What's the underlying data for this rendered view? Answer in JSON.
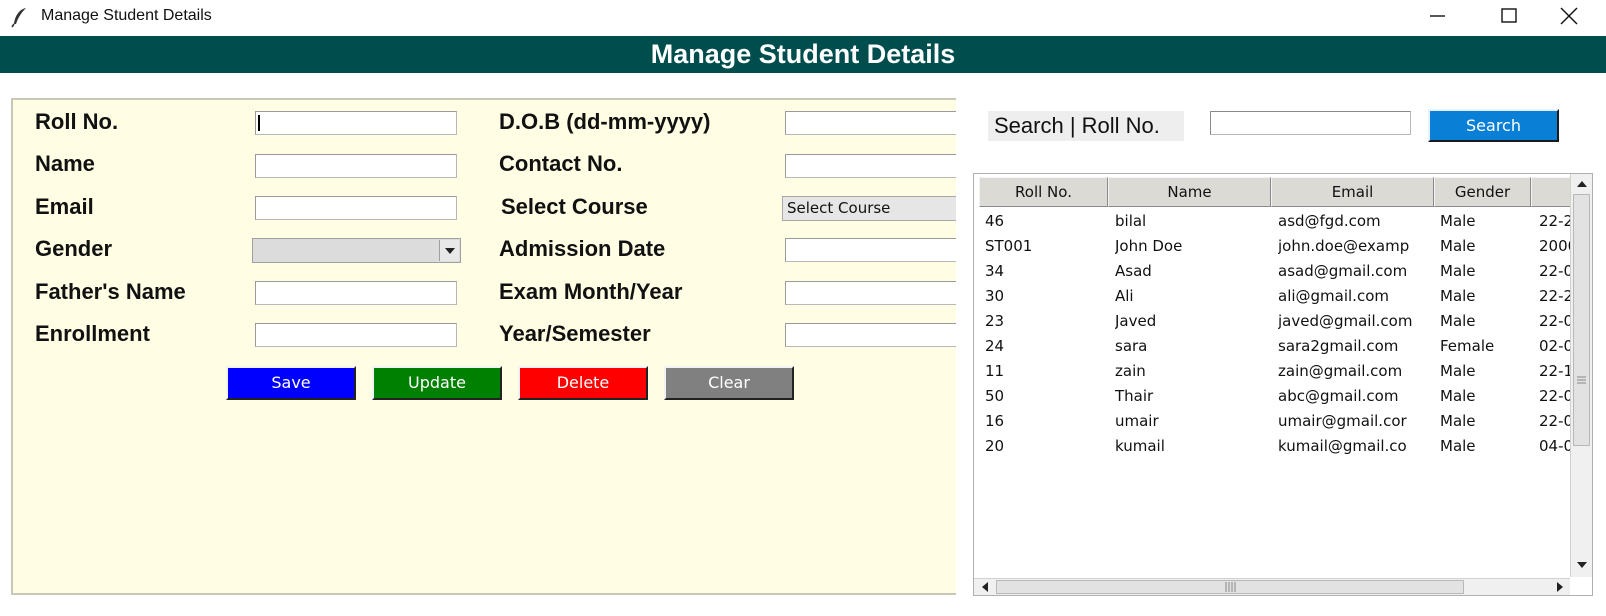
{
  "window": {
    "title": "Manage Student Details"
  },
  "banner": {
    "title": "Manage Student Details"
  },
  "form": {
    "fields_left": [
      {
        "label": "Roll No.",
        "value": ""
      },
      {
        "label": "Name",
        "value": ""
      },
      {
        "label": "Email",
        "value": ""
      },
      {
        "label": "Gender",
        "value": ""
      },
      {
        "label": "Father's Name",
        "value": ""
      },
      {
        "label": "Enrollment",
        "value": ""
      }
    ],
    "fields_right": [
      {
        "label": "D.O.B (dd-mm-yyyy)",
        "value": ""
      },
      {
        "label": "Contact No.",
        "value": ""
      },
      {
        "label": "Select Course",
        "value": "Select Course"
      },
      {
        "label": "Admission Date",
        "value": ""
      },
      {
        "label": "Exam Month/Year",
        "value": ""
      },
      {
        "label": "Year/Semester",
        "value": ""
      }
    ],
    "buttons": {
      "save": "Save",
      "update": "Update",
      "delete": "Delete",
      "clear": "Clear"
    },
    "button_colors": {
      "save": "#0000ff",
      "update": "#008000",
      "delete": "#ff0000",
      "clear": "#808080"
    }
  },
  "search": {
    "label": "Search | Roll No.",
    "value": "",
    "button": "Search"
  },
  "table": {
    "columns": [
      "Roll No.",
      "Name",
      "Email",
      "Gender",
      ""
    ],
    "rows": [
      [
        "46",
        "bilal",
        "asd@fgd.com",
        "Male",
        "22-2"
      ],
      [
        "ST001",
        "John Doe",
        "john.doe@examp",
        "Male",
        "2000"
      ],
      [
        "34",
        "Asad",
        "asad@gmail.com",
        "Male",
        "22-0"
      ],
      [
        "30",
        "Ali",
        "ali@gmail.com",
        "Male",
        "22-2"
      ],
      [
        "23",
        "Javed",
        "javed@gmail.com",
        "Male",
        "22-0"
      ],
      [
        "24",
        "sara",
        "sara2gmail.com",
        "Female",
        "02-0"
      ],
      [
        "11",
        "zain",
        "zain@gmail.com",
        "Male",
        "22-1"
      ],
      [
        "50",
        "Thair",
        "abc@gmail.com",
        "Male",
        "22-0"
      ],
      [
        "16",
        "umair",
        "umair@gmail.cor",
        "Male",
        "22-0"
      ],
      [
        "20",
        "kumail",
        "kumail@gmail.co",
        "Male",
        "04-0"
      ]
    ]
  },
  "colors": {
    "banner_bg": "#004d4d",
    "form_bg": "#fffde3",
    "search_button_bg": "#0a7fd6"
  }
}
